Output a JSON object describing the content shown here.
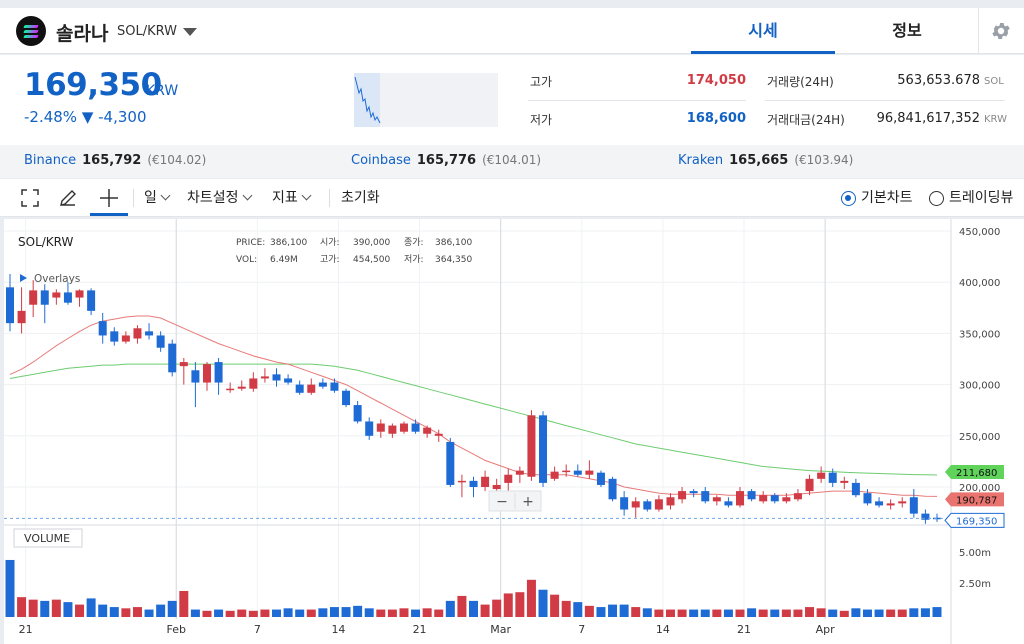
{
  "header": {
    "coin_name": "솔라나",
    "pair": "SOL/KRW",
    "tabs": [
      {
        "label": "시세"
      },
      {
        "label": "정보"
      }
    ]
  },
  "price": {
    "value": "169,350",
    "unit": "KRW",
    "change": "-2.48% ▼ -4,300"
  },
  "stats": {
    "high_label": "고가",
    "high_value": "174,050",
    "low_label": "저가",
    "low_value": "168,600",
    "volume_label": "거래량(24H)",
    "volume_value": "563,653.678",
    "volume_unit": "SOL",
    "amount_label": "거래대금(24H)",
    "amount_value": "96,841,617,352",
    "amount_unit": "KRW"
  },
  "exchanges": [
    {
      "name": "Binance",
      "price": "165,792",
      "eur": "(€104.02)"
    },
    {
      "name": "Coinbase",
      "price": "165,776",
      "eur": "(€104.01)"
    },
    {
      "name": "Kraken",
      "price": "165,665",
      "eur": "(€103.94)"
    }
  ],
  "toolbar": {
    "interval": "일",
    "chart_settings": "차트설정",
    "indicators": "지표",
    "reset": "초기화",
    "basic_chart": "기본차트",
    "trading_view": "트레이딩뷰"
  },
  "chart": {
    "symbol": "SOL/KRW",
    "overlays": "Overlays",
    "volume_label": "VOLUME",
    "legend": {
      "price_k": "PRICE:",
      "price_v": "386,100",
      "open_k": "시가:",
      "open_v": "390,000",
      "close_k": "종가:",
      "close_v": "386,100",
      "vol_k": "VOL:",
      "vol_v": "6.49M",
      "high_k": "고가:",
      "high_v": "454,500",
      "low_k": "저가:",
      "low_v": "364,350"
    },
    "zoom_out": "−",
    "zoom_in": "+",
    "price_ticks": [
      "450,000",
      "400,000",
      "350,000",
      "300,000",
      "250,000",
      "200,000"
    ],
    "volume_ticks": [
      "5.00m",
      "2.50m"
    ],
    "date_ticks": [
      "21",
      "Feb",
      "7",
      "14",
      "21",
      "Mar",
      "7",
      "14",
      "21",
      "Apr"
    ],
    "tag_ma_slow": "211,680",
    "tag_ma_fast": "190,787",
    "tag_last": "169,350",
    "colors": {
      "up": "#d13b45",
      "down": "#1e6bd6",
      "ma_fast": "#e77a78",
      "ma_slow": "#6dcc6f"
    }
  },
  "chart_data": {
    "type": "candlestick",
    "title": "SOL/KRW",
    "ylim": [
      155000,
      460000
    ],
    "candles": [
      {
        "o": 395000,
        "h": 408000,
        "l": 352000,
        "c": 360000
      },
      {
        "o": 360000,
        "h": 395000,
        "l": 350000,
        "c": 372000
      },
      {
        "o": 378000,
        "h": 402000,
        "l": 366000,
        "c": 392000
      },
      {
        "o": 392000,
        "h": 398000,
        "l": 360000,
        "c": 378000
      },
      {
        "o": 385000,
        "h": 393000,
        "l": 378000,
        "c": 390000
      },
      {
        "o": 390000,
        "h": 400000,
        "l": 378000,
        "c": 380000
      },
      {
        "o": 385000,
        "h": 393000,
        "l": 376000,
        "c": 392000
      },
      {
        "o": 392000,
        "h": 394000,
        "l": 368000,
        "c": 372000
      },
      {
        "o": 362000,
        "h": 370000,
        "l": 340000,
        "c": 348000
      },
      {
        "o": 352000,
        "h": 356000,
        "l": 338000,
        "c": 342000
      },
      {
        "o": 342000,
        "h": 352000,
        "l": 340000,
        "c": 348000
      },
      {
        "o": 345000,
        "h": 358000,
        "l": 340000,
        "c": 355000
      },
      {
        "o": 352000,
        "h": 360000,
        "l": 344000,
        "c": 348000
      },
      {
        "o": 348000,
        "h": 352000,
        "l": 332000,
        "c": 336000
      },
      {
        "o": 340000,
        "h": 344000,
        "l": 308000,
        "c": 312000
      },
      {
        "o": 318000,
        "h": 326000,
        "l": 300000,
        "c": 322000
      },
      {
        "o": 314000,
        "h": 322000,
        "l": 278000,
        "c": 302000
      },
      {
        "o": 302000,
        "h": 322000,
        "l": 294000,
        "c": 320000
      },
      {
        "o": 322000,
        "h": 326000,
        "l": 290000,
        "c": 302000
      },
      {
        "o": 296000,
        "h": 302000,
        "l": 292000,
        "c": 296000
      },
      {
        "o": 296000,
        "h": 304000,
        "l": 294000,
        "c": 298000
      },
      {
        "o": 296000,
        "h": 312000,
        "l": 293000,
        "c": 306000
      },
      {
        "o": 306000,
        "h": 316000,
        "l": 302000,
        "c": 308000
      },
      {
        "o": 310000,
        "h": 316000,
        "l": 298000,
        "c": 304000
      },
      {
        "o": 306000,
        "h": 310000,
        "l": 300000,
        "c": 302000
      },
      {
        "o": 300000,
        "h": 304000,
        "l": 290000,
        "c": 292000
      },
      {
        "o": 292000,
        "h": 306000,
        "l": 290000,
        "c": 300000
      },
      {
        "o": 302000,
        "h": 306000,
        "l": 296000,
        "c": 298000
      },
      {
        "o": 302000,
        "h": 306000,
        "l": 292000,
        "c": 294000
      },
      {
        "o": 294000,
        "h": 296000,
        "l": 278000,
        "c": 280000
      },
      {
        "o": 280000,
        "h": 284000,
        "l": 262000,
        "c": 264000
      },
      {
        "o": 264000,
        "h": 268000,
        "l": 246000,
        "c": 250000
      },
      {
        "o": 254000,
        "h": 266000,
        "l": 248000,
        "c": 262000
      },
      {
        "o": 252000,
        "h": 262000,
        "l": 248000,
        "c": 260000
      },
      {
        "o": 254000,
        "h": 264000,
        "l": 252000,
        "c": 262000
      },
      {
        "o": 262000,
        "h": 266000,
        "l": 252000,
        "c": 254000
      },
      {
        "o": 252000,
        "h": 260000,
        "l": 248000,
        "c": 258000
      },
      {
        "o": 250000,
        "h": 256000,
        "l": 244000,
        "c": 252000
      },
      {
        "o": 244000,
        "h": 248000,
        "l": 200000,
        "c": 202000
      },
      {
        "o": 206000,
        "h": 212000,
        "l": 190000,
        "c": 206000
      },
      {
        "o": 206000,
        "h": 210000,
        "l": 190000,
        "c": 200000
      },
      {
        "o": 200000,
        "h": 216000,
        "l": 196000,
        "c": 210000
      },
      {
        "o": 198000,
        "h": 208000,
        "l": 194000,
        "c": 202000
      },
      {
        "o": 204000,
        "h": 218000,
        "l": 192000,
        "c": 212000
      },
      {
        "o": 212000,
        "h": 220000,
        "l": 204000,
        "c": 216000
      },
      {
        "o": 210000,
        "h": 275000,
        "l": 206000,
        "c": 270000
      },
      {
        "o": 270000,
        "h": 274000,
        "l": 200000,
        "c": 204000
      },
      {
        "o": 208000,
        "h": 220000,
        "l": 206000,
        "c": 215000
      },
      {
        "o": 216000,
        "h": 222000,
        "l": 210000,
        "c": 216000
      },
      {
        "o": 216000,
        "h": 222000,
        "l": 210000,
        "c": 212000
      },
      {
        "o": 212000,
        "h": 226000,
        "l": 208000,
        "c": 216000
      },
      {
        "o": 214000,
        "h": 216000,
        "l": 200000,
        "c": 202000
      },
      {
        "o": 208000,
        "h": 210000,
        "l": 186000,
        "c": 188000
      },
      {
        "o": 190000,
        "h": 196000,
        "l": 172000,
        "c": 178000
      },
      {
        "o": 180000,
        "h": 190000,
        "l": 170000,
        "c": 186000
      },
      {
        "o": 186000,
        "h": 188000,
        "l": 176000,
        "c": 178000
      },
      {
        "o": 178000,
        "h": 192000,
        "l": 176000,
        "c": 188000
      },
      {
        "o": 182000,
        "h": 194000,
        "l": 178000,
        "c": 190000
      },
      {
        "o": 188000,
        "h": 200000,
        "l": 184000,
        "c": 196000
      },
      {
        "o": 196000,
        "h": 198000,
        "l": 190000,
        "c": 194000
      },
      {
        "o": 196000,
        "h": 200000,
        "l": 184000,
        "c": 186000
      },
      {
        "o": 186000,
        "h": 192000,
        "l": 182000,
        "c": 190000
      },
      {
        "o": 186000,
        "h": 190000,
        "l": 180000,
        "c": 182000
      },
      {
        "o": 182000,
        "h": 200000,
        "l": 180000,
        "c": 196000
      },
      {
        "o": 196000,
        "h": 198000,
        "l": 186000,
        "c": 188000
      },
      {
        "o": 186000,
        "h": 196000,
        "l": 184000,
        "c": 192000
      },
      {
        "o": 192000,
        "h": 194000,
        "l": 184000,
        "c": 186000
      },
      {
        "o": 186000,
        "h": 194000,
        "l": 184000,
        "c": 190000
      },
      {
        "o": 188000,
        "h": 198000,
        "l": 186000,
        "c": 194000
      },
      {
        "o": 196000,
        "h": 212000,
        "l": 192000,
        "c": 208000
      },
      {
        "o": 208000,
        "h": 220000,
        "l": 204000,
        "c": 214000
      },
      {
        "o": 214000,
        "h": 218000,
        "l": 200000,
        "c": 204000
      },
      {
        "o": 204000,
        "h": 210000,
        "l": 198000,
        "c": 206000
      },
      {
        "o": 204000,
        "h": 208000,
        "l": 190000,
        "c": 192000
      },
      {
        "o": 194000,
        "h": 198000,
        "l": 182000,
        "c": 184000
      },
      {
        "o": 186000,
        "h": 190000,
        "l": 180000,
        "c": 182000
      },
      {
        "o": 182000,
        "h": 188000,
        "l": 178000,
        "c": 184000
      },
      {
        "o": 184000,
        "h": 190000,
        "l": 180000,
        "c": 186000
      },
      {
        "o": 190000,
        "h": 198000,
        "l": 170000,
        "c": 174000
      },
      {
        "o": 174000,
        "h": 178000,
        "l": 164000,
        "c": 168000
      },
      {
        "o": 170000,
        "h": 174000,
        "l": 166000,
        "c": 169350
      }
    ],
    "volume": [
      4.6,
      1.6,
      1.4,
      1.3,
      1.4,
      1.2,
      1.0,
      1.5,
      1.0,
      0.8,
      0.7,
      0.8,
      0.6,
      1.0,
      1.3,
      2.1,
      0.6,
      0.5,
      0.6,
      0.5,
      0.6,
      0.5,
      0.6,
      0.6,
      0.7,
      0.6,
      0.6,
      0.7,
      0.8,
      0.8,
      0.9,
      0.7,
      0.6,
      0.6,
      0.7,
      0.6,
      0.7,
      0.6,
      1.3,
      1.7,
      1.3,
      1.0,
      1.4,
      1.9,
      2.0,
      3.0,
      2.2,
      1.8,
      1.3,
      1.2,
      0.9,
      0.8,
      1.0,
      1.0,
      0.8,
      0.7,
      0.6,
      0.6,
      0.6,
      0.6,
      0.6,
      0.6,
      0.6,
      0.6,
      0.7,
      0.6,
      0.6,
      0.6,
      0.6,
      0.8,
      0.7,
      0.6,
      0.5,
      0.7,
      0.6,
      0.6,
      0.6,
      0.6,
      0.7,
      0.7,
      0.8
    ],
    "ma_fast": [
      310000,
      315000,
      322000,
      330000,
      338000,
      345000,
      352000,
      358000,
      362000,
      364000,
      366000,
      367000,
      367000,
      365000,
      360000,
      355000,
      350000,
      345000,
      340000,
      336000,
      332000,
      328000,
      325000,
      322000,
      320000,
      316000,
      312000,
      308000,
      304000,
      300000,
      294000,
      288000,
      282000,
      276000,
      270000,
      264000,
      258000,
      252000,
      244000,
      238000,
      232000,
      226000,
      222000,
      218000,
      214000,
      212000,
      212000,
      212000,
      212000,
      210000,
      208000,
      206000,
      204000,
      200000,
      198000,
      196000,
      194000,
      193000,
      193000,
      193000,
      193000,
      193000,
      192000,
      192000,
      192000,
      192000,
      192000,
      192000,
      193000,
      194000,
      195000,
      196000,
      196000,
      196000,
      195000,
      194000,
      193000,
      192000,
      192000,
      191000,
      190787
    ],
    "ma_slow": [
      306000,
      308000,
      310000,
      312000,
      314000,
      316000,
      317000,
      318000,
      319000,
      319000,
      320000,
      320000,
      320000,
      320000,
      320000,
      320000,
      320000,
      320000,
      320000,
      320000,
      320000,
      320000,
      320000,
      320000,
      320000,
      320000,
      320000,
      319000,
      318000,
      316000,
      314000,
      311000,
      308000,
      305000,
      302000,
      299000,
      296000,
      293000,
      290000,
      287000,
      284000,
      281000,
      278000,
      275000,
      272000,
      269000,
      266000,
      263000,
      260000,
      257000,
      254000,
      251000,
      248000,
      245000,
      242000,
      240000,
      238000,
      236000,
      234000,
      232000,
      230000,
      228000,
      226000,
      224000,
      222000,
      220000,
      219000,
      218000,
      217000,
      216000,
      215500,
      215000,
      214500,
      214000,
      213600,
      213200,
      212800,
      212400,
      212100,
      211900,
      211680
    ]
  }
}
